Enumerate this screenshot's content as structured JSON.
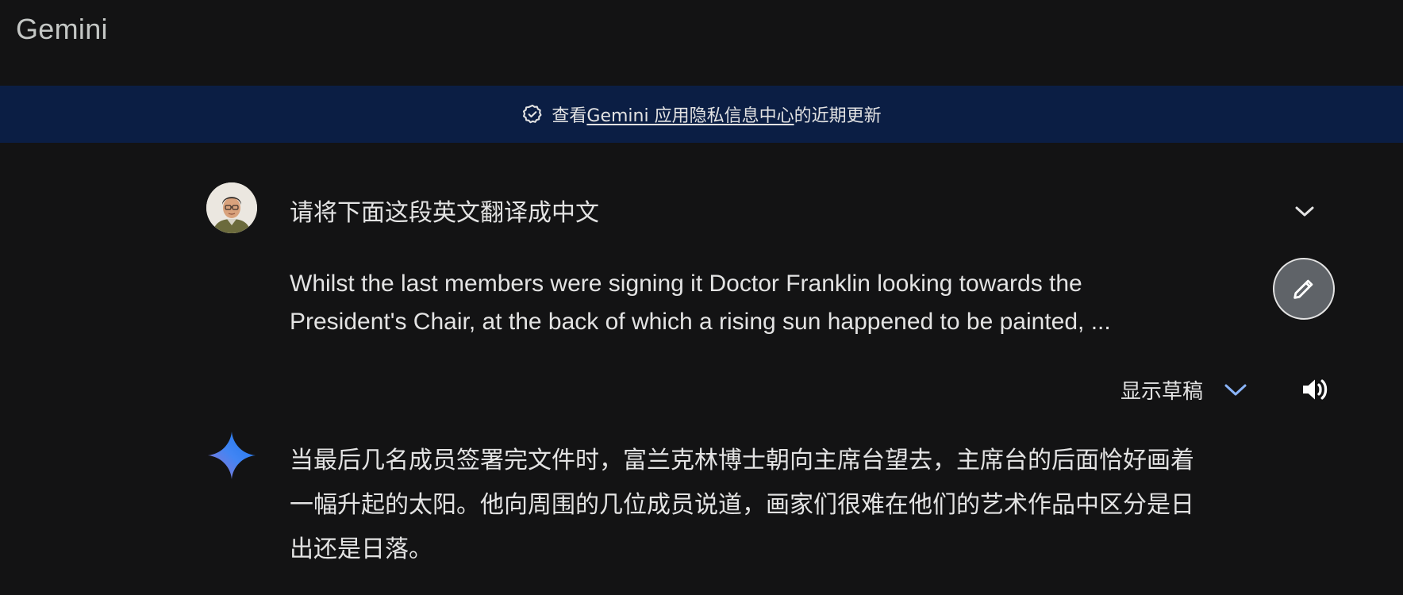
{
  "app": {
    "title": "Gemini"
  },
  "banner": {
    "prefix": "查看 ",
    "link": "Gemini 应用隐私信息中心",
    "suffix": "的近期更新"
  },
  "prompt": {
    "title": "请将下面这段英文翻译成中文",
    "body_lines": [
      "Whilst the last members were signing it Doctor Franklin looking towards the",
      "President's Chair, at the back of which a rising sun happened to be painted, ..."
    ]
  },
  "controls": {
    "drafts_label": "显示草稿"
  },
  "response": {
    "lines": [
      "当最后几名成员签署完文件时，富兰克林博士朝向主席台望去，主席台的后面恰好画着",
      "一幅升起的太阳。他向周围的几位成员说道，画家们很难在他们的艺术作品中区分是日",
      "出还是日落。"
    ]
  },
  "icons": {
    "banner": "verified-shield-icon",
    "expand": "chevron-down-icon",
    "edit": "pencil-icon",
    "drafts": "chevron-down-icon",
    "speaker": "speaker-icon",
    "assistant": "gemini-spark-icon"
  },
  "colors": {
    "background": "#131314",
    "banner": "#0b1e44",
    "text": "#e3e3e3",
    "accent": "#8ab4f8",
    "edit_button": "#5f6368"
  }
}
